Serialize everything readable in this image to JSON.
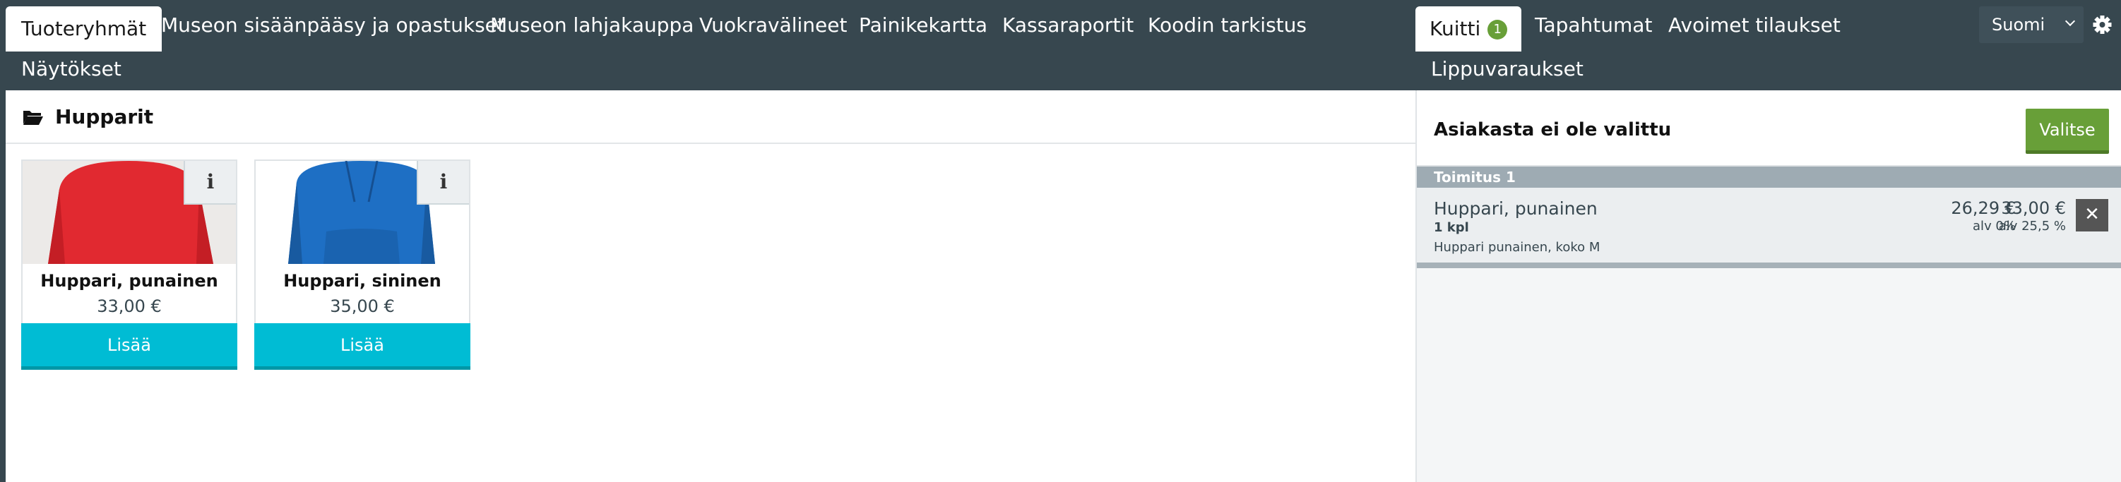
{
  "top_tabs": [
    {
      "label": "Tuoteryhmät",
      "active": true
    },
    {
      "label": "Museon sisäänpääsy ja opastukset"
    },
    {
      "label": "Museon lahjakauppa"
    },
    {
      "label": "Vuokravälineet"
    },
    {
      "label": "Painikekartta"
    },
    {
      "label": "Kassaraportit"
    },
    {
      "label": "Koodin tarkistus"
    },
    {
      "label": "Näytökset"
    }
  ],
  "right_tabs": [
    {
      "label": "Kuitti",
      "badge": "1",
      "active": true
    },
    {
      "label": "Tapahtumat"
    },
    {
      "label": "Avoimet tilaukset"
    },
    {
      "label": "Lippuvaraukset"
    }
  ],
  "language": {
    "selected": "Suomi"
  },
  "settings_icon": "gear-icon",
  "breadcrumb": {
    "icon": "folder-open-icon",
    "title": "Hupparit"
  },
  "products": [
    {
      "name": "Huppari, punainen",
      "price": "33,00 €",
      "add_label": "Lisää",
      "info_label": "i",
      "image_color": "#e53935"
    },
    {
      "name": "Huppari, sininen",
      "price": "35,00 €",
      "add_label": "Lisää",
      "info_label": "i",
      "image_color": "#1e6fc4"
    }
  ],
  "receipt": {
    "customer_label": "Asiakasta ei ole valittu",
    "select_label": "Valitse",
    "shipment_label": "Toimitus 1",
    "line_items": [
      {
        "name": "Huppari, punainen",
        "quantity": "1 kpl",
        "note": "Huppari punainen, koko M",
        "net_amount": "26,29 €",
        "net_vat": "alv 0%",
        "gross_amount": "33,00 €",
        "gross_vat": "alv 25,5 %",
        "remove_label": "✕"
      }
    ]
  },
  "colors": {
    "header_bg": "#37474f",
    "accent_cyan": "#00bcd4",
    "accent_green": "#689f38"
  }
}
